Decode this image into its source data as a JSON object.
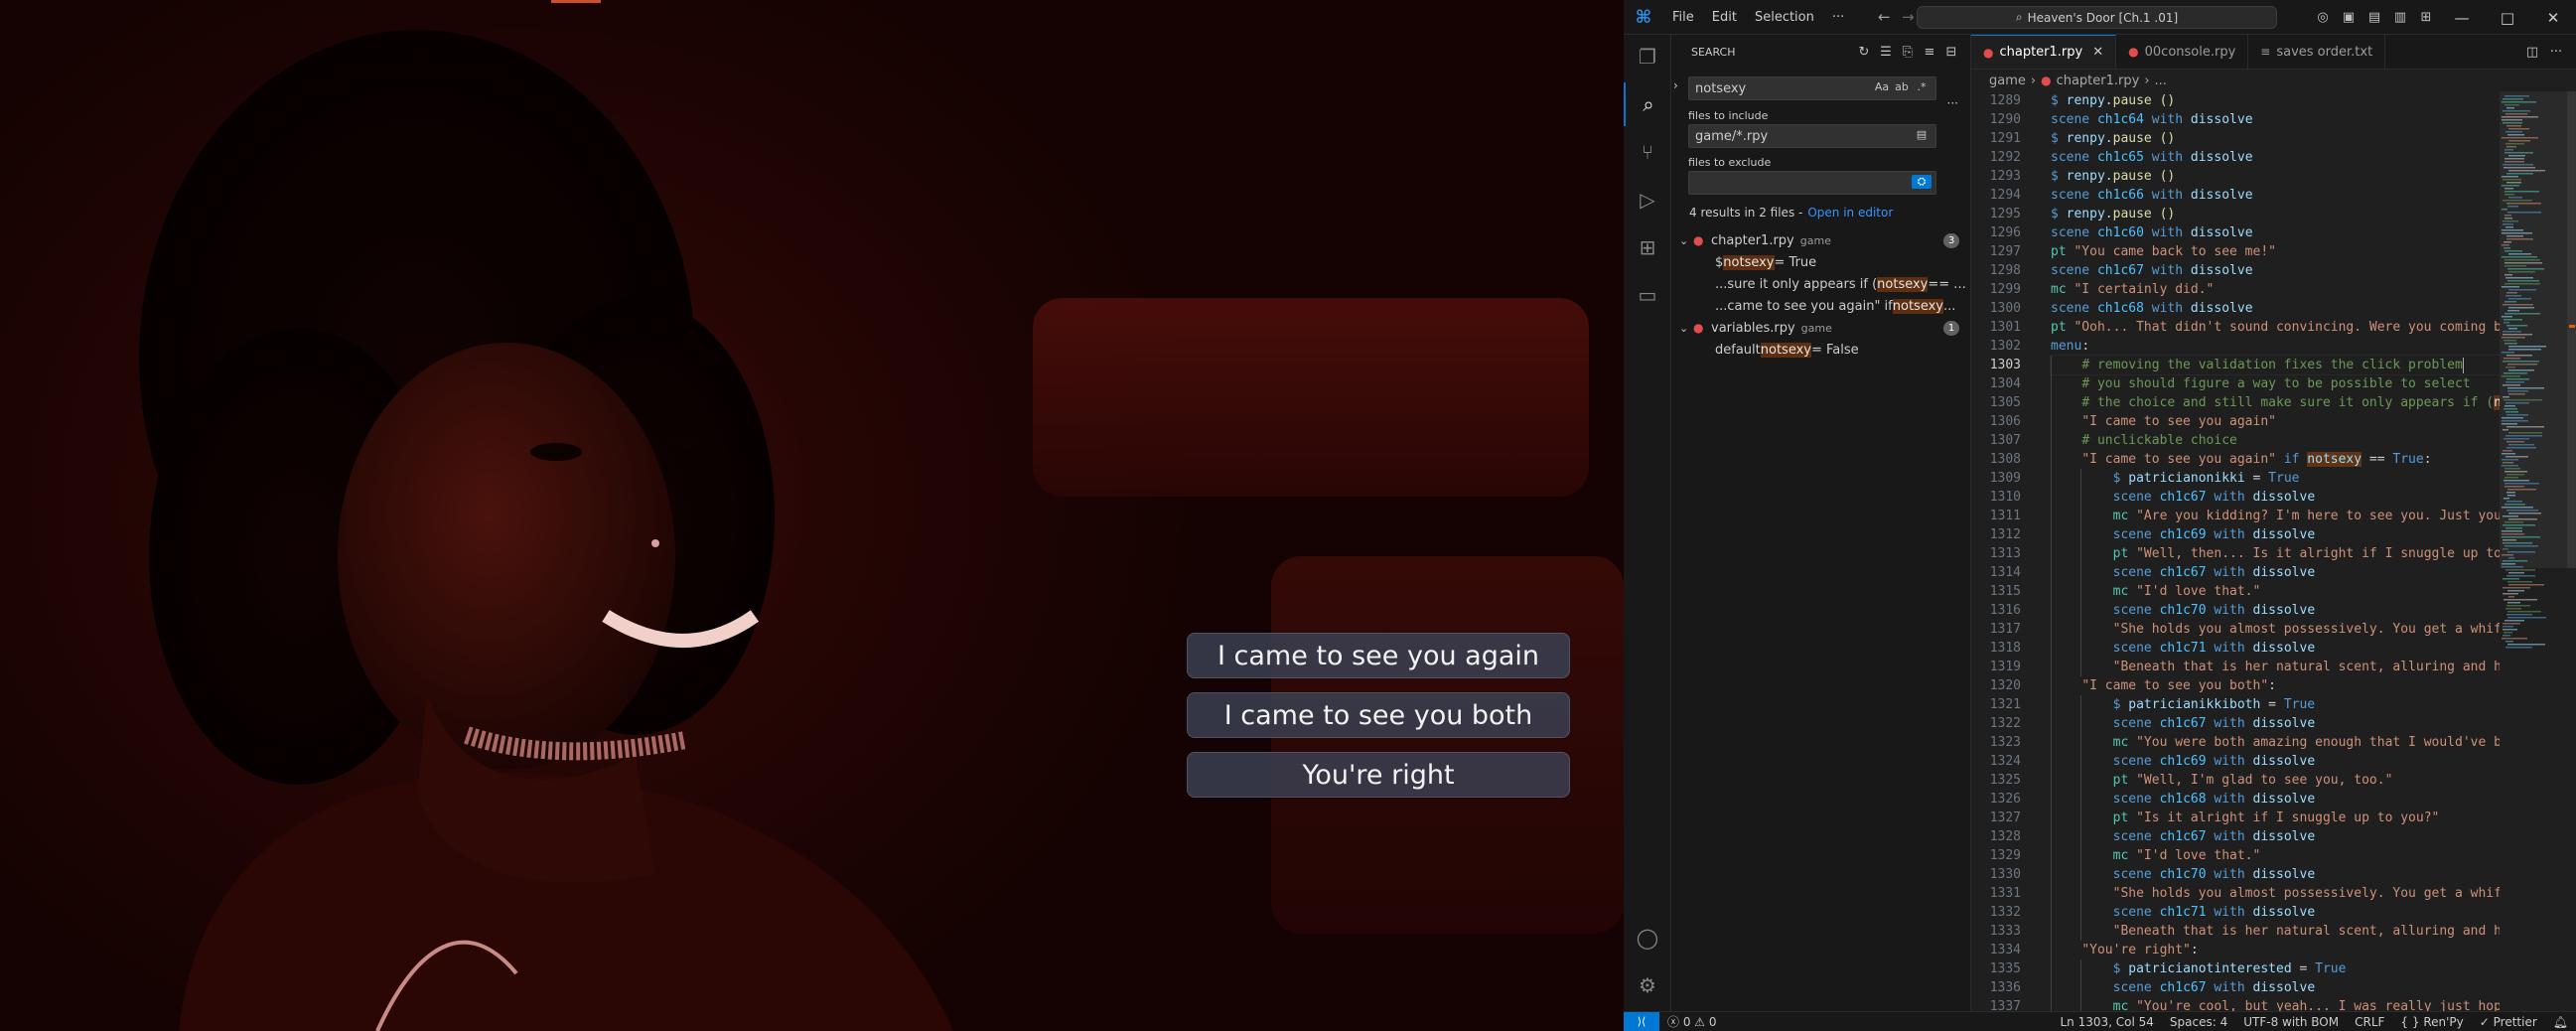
{
  "game": {
    "choices": [
      "I came to see you again",
      "I came to see you both",
      "You're right"
    ]
  },
  "titlebar": {
    "menu": [
      "File",
      "Edit",
      "Selection",
      "···"
    ],
    "search": "Heaven's Door [Ch.1 .01]",
    "window_controls": [
      "—",
      "□",
      "✕"
    ]
  },
  "search": {
    "title": "SEARCH",
    "query": "notsexy",
    "options": [
      "Aa",
      "ab",
      ".*"
    ],
    "include_label": "files to include",
    "include_value": "game/*.rpy",
    "exclude_label": "files to exclude",
    "exclude_value": "",
    "summary": "4 results in 2 files -",
    "open_in_editor": "Open in editor",
    "files": [
      {
        "name": "chapter1.rpy",
        "dir": "game",
        "count": "3",
        "matches": [
          {
            "pre": "$ ",
            "hit": "notsexy",
            "post": " = True"
          },
          {
            "pre": "...sure it only appears if (",
            "hit": "notsexy",
            "post": " == ..."
          },
          {
            "pre": "...came to see you again\" if ",
            "hit": "notsexy",
            "post": " ..."
          }
        ]
      },
      {
        "name": "variables.rpy",
        "dir": "game",
        "count": "1",
        "matches": [
          {
            "pre": "default ",
            "hit": "notsexy",
            "post": " = False"
          }
        ]
      }
    ]
  },
  "tabs": [
    {
      "label": "chapter1.rpy",
      "active": true
    },
    {
      "label": "00console.rpy",
      "active": false
    },
    {
      "label": "saves order.txt",
      "active": false
    }
  ],
  "breadcrumb": [
    "game",
    "chapter1.rpy",
    "..."
  ],
  "editor": {
    "current_line": 1303,
    "lines": [
      {
        "n": 1289,
        "code": "$ renpy.pause ()"
      },
      {
        "n": 1290,
        "code": "scene ch1c64 with dissolve"
      },
      {
        "n": 1291,
        "code": "$ renpy.pause ()"
      },
      {
        "n": 1292,
        "code": "scene ch1c65 with dissolve"
      },
      {
        "n": 1293,
        "code": "$ renpy.pause ()"
      },
      {
        "n": 1294,
        "code": "scene ch1c66 with dissolve"
      },
      {
        "n": 1295,
        "code": "$ renpy.pause ()"
      },
      {
        "n": 1296,
        "code": "scene ch1c60 with dissolve"
      },
      {
        "n": 1297,
        "code": "pt \"You came back to see me!\""
      },
      {
        "n": 1298,
        "code": "scene ch1c67 with dissolve"
      },
      {
        "n": 1299,
        "code": "mc \"I certainly did.\""
      },
      {
        "n": 1300,
        "code": "scene ch1c68 with dissolve"
      },
      {
        "n": 1301,
        "code": "pt \"Ooh... That didn't sound convincing. Were you coming back to"
      },
      {
        "n": 1302,
        "code": "menu:"
      },
      {
        "n": 1303,
        "code": "    # removing the validation fixes the click problem"
      },
      {
        "n": 1304,
        "code": "    # you should figure a way to be possible to select"
      },
      {
        "n": 1305,
        "code": "    # the choice and still make sure it only appears if (notsexy"
      },
      {
        "n": 1306,
        "code": "    \"I came to see you again\""
      },
      {
        "n": 1307,
        "code": "    # unclickable choice"
      },
      {
        "n": 1308,
        "code": "    \"I came to see you again\" if notsexy == True:"
      },
      {
        "n": 1309,
        "code": "        $ patricianonikki = True"
      },
      {
        "n": 1310,
        "code": "        scene ch1c67 with dissolve"
      },
      {
        "n": 1311,
        "code": "        mc \"Are you kidding? I'm here to see you. Just you.\""
      },
      {
        "n": 1312,
        "code": "        scene ch1c69 with dissolve"
      },
      {
        "n": 1313,
        "code": "        pt \"Well, then... Is it alright if I snuggle up to you?\""
      },
      {
        "n": 1314,
        "code": "        scene ch1c67 with dissolve"
      },
      {
        "n": 1315,
        "code": "        mc \"I'd love that.\""
      },
      {
        "n": 1316,
        "code": "        scene ch1c70 with dissolve"
      },
      {
        "n": 1317,
        "code": "        \"She holds you almost possessively. You get a whiff of h"
      },
      {
        "n": 1318,
        "code": "        scene ch1c71 with dissolve"
      },
      {
        "n": 1319,
        "code": "        \"Beneath that is her natural scent, alluring and heady."
      },
      {
        "n": 1320,
        "code": "    \"I came to see you both\":"
      },
      {
        "n": 1321,
        "code": "        $ patricianikkiboth = True"
      },
      {
        "n": 1322,
        "code": "        scene ch1c67 with dissolve"
      },
      {
        "n": 1323,
        "code": "        mc \"You were both amazing enough that I would've been ha"
      },
      {
        "n": 1324,
        "code": "        scene ch1c69 with dissolve"
      },
      {
        "n": 1325,
        "code": "        pt \"Well, I'm glad to see you, too.\""
      },
      {
        "n": 1326,
        "code": "        scene ch1c68 with dissolve"
      },
      {
        "n": 1327,
        "code": "        pt \"Is it alright if I snuggle up to you?\""
      },
      {
        "n": 1328,
        "code": "        scene ch1c67 with dissolve"
      },
      {
        "n": 1329,
        "code": "        mc \"I'd love that.\""
      },
      {
        "n": 1330,
        "code": "        scene ch1c70 with dissolve"
      },
      {
        "n": 1331,
        "code": "        \"She holds you almost possessively. You get a whiff of h"
      },
      {
        "n": 1332,
        "code": "        scene ch1c71 with dissolve"
      },
      {
        "n": 1333,
        "code": "        \"Beneath that is her natural scent, alluring and heady."
      },
      {
        "n": 1334,
        "code": "    \"You're right\":"
      },
      {
        "n": 1335,
        "code": "        $ patricianotinterested = True"
      },
      {
        "n": 1336,
        "code": "        scene ch1c67 with dissolve"
      },
      {
        "n": 1337,
        "code": "        mc \"You're cool, but yeah... I was really just hoping to"
      }
    ]
  },
  "statusbar": {
    "problems": "ⓧ 0 ⚠ 0",
    "position": "Ln 1303, Col 54",
    "spaces": "Spaces: 4",
    "encoding": "UTF-8 with BOM",
    "eol": "CRLF",
    "language": "{ } Ren'Py",
    "prettier": "✓ Prettier"
  },
  "colors": {
    "accent": "#0078d4",
    "match_highlight": "#ea5c00",
    "game_background": "#250605"
  }
}
